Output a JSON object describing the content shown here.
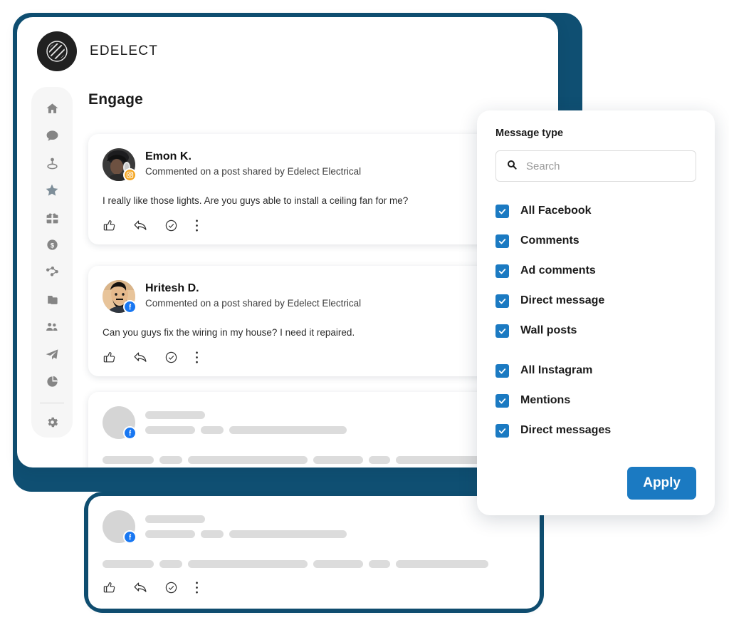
{
  "theme": {
    "frame_navy": "#0f4f72",
    "accent_blue": "#1B7AC2",
    "facebook_blue": "#1877F2",
    "instagram_orange": "#F5A623",
    "skeleton_gray": "#dcdcdc"
  },
  "brand": {
    "name": "EDELECT",
    "logo_icon": "hatched-circle-logo-icon"
  },
  "sidebar": {
    "items": [
      {
        "icon": "home-icon",
        "name": "home"
      },
      {
        "icon": "chat-bubble-icon",
        "name": "messages"
      },
      {
        "icon": "location-pin-icon",
        "name": "locations"
      },
      {
        "icon": "star-icon",
        "name": "reviews"
      },
      {
        "icon": "gift-box-icon",
        "name": "promotions"
      },
      {
        "icon": "dollar-coin-icon",
        "name": "payments"
      },
      {
        "icon": "share-nodes-icon",
        "name": "network"
      },
      {
        "icon": "layers-icon",
        "name": "library"
      },
      {
        "icon": "users-icon",
        "name": "contacts"
      },
      {
        "icon": "paper-plane-icon",
        "name": "send"
      },
      {
        "icon": "pie-chart-icon",
        "name": "analytics"
      }
    ],
    "footer_items": [
      {
        "icon": "gear-icon",
        "name": "settings"
      }
    ]
  },
  "main": {
    "page_title": "Engage",
    "cards": [
      {
        "type": "message",
        "author": "Emon K.",
        "subtitle": "Commented on a post shared by Edelect Electrical",
        "body": "I really like those lights. Are you guys able to install  a ceiling fan for me?",
        "network": "instagram",
        "avatar": "photo-avatar-emon"
      },
      {
        "type": "message",
        "author": "Hritesh D.",
        "subtitle": "Commented on a post shared by Edelect Electrical",
        "body": "Can you guys fix the wiring in my house? I need it repaired.",
        "network": "facebook",
        "avatar": "photo-avatar-hritesh"
      },
      {
        "type": "skeleton",
        "network": "facebook"
      },
      {
        "type": "skeleton",
        "network": "facebook"
      }
    ],
    "card_actions": [
      {
        "icon": "thumbs-up-icon",
        "name": "like"
      },
      {
        "icon": "reply-arrow-icon",
        "name": "reply"
      },
      {
        "icon": "check-circle-icon",
        "name": "mark-complete"
      },
      {
        "icon": "more-vertical-icon",
        "name": "more-options"
      }
    ]
  },
  "filter_panel": {
    "title": "Message type",
    "search": {
      "placeholder": "Search",
      "value": "",
      "icon": "search-icon"
    },
    "groups": [
      {
        "options": [
          {
            "label": "All Facebook",
            "checked": true
          },
          {
            "label": "Comments",
            "checked": true
          },
          {
            "label": "Ad comments",
            "checked": true
          },
          {
            "label": "Direct message",
            "checked": true
          },
          {
            "label": "Wall posts",
            "checked": true
          }
        ]
      },
      {
        "options": [
          {
            "label": "All Instagram",
            "checked": true
          },
          {
            "label": "Mentions",
            "checked": true
          },
          {
            "label": "Direct messages",
            "checked": true
          }
        ]
      }
    ],
    "apply_label": "Apply"
  }
}
